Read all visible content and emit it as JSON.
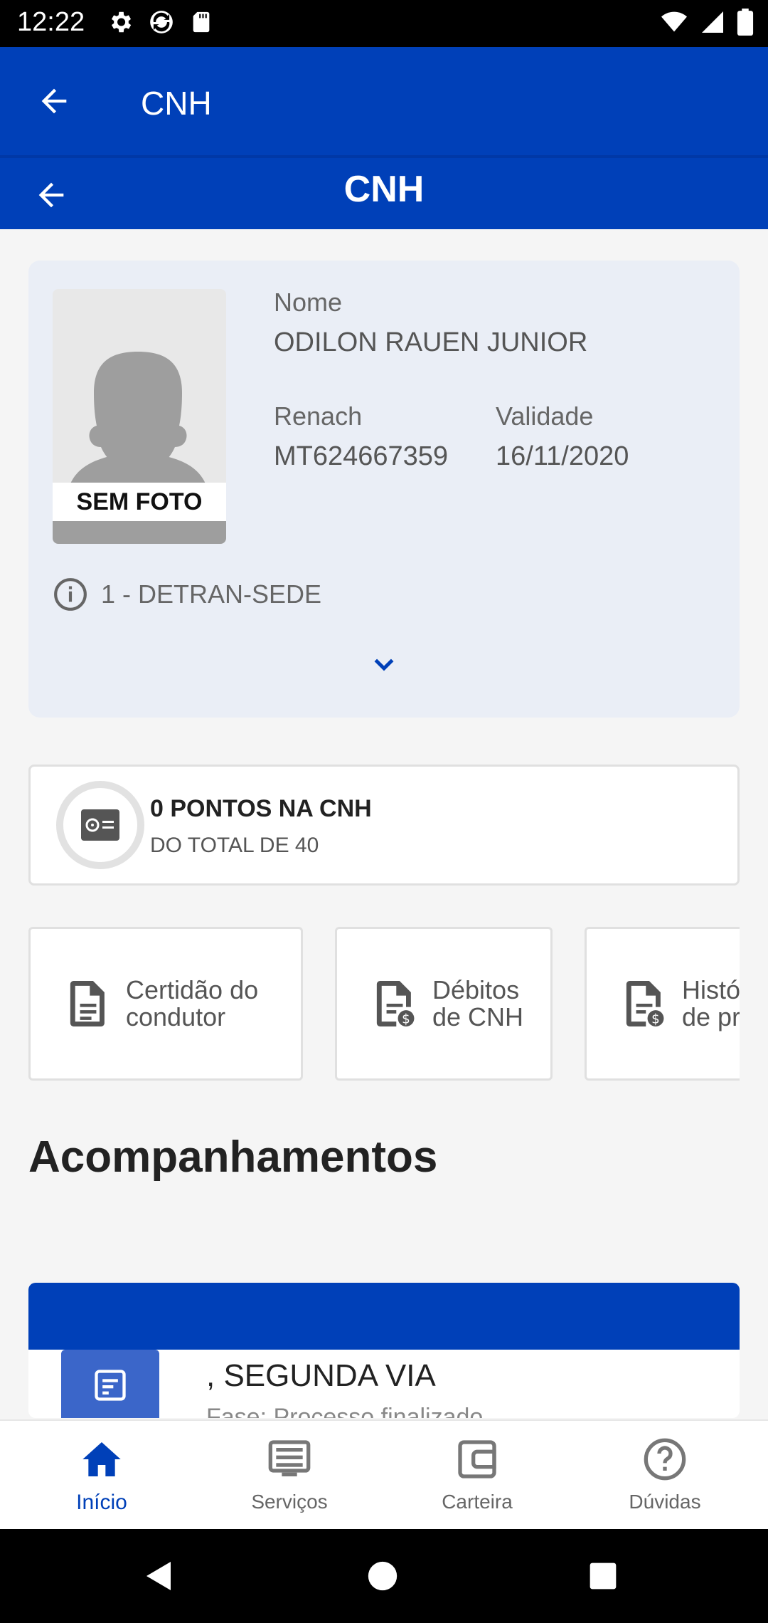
{
  "status_bar": {
    "time": "12:22"
  },
  "app_bar": {
    "title": "CNH"
  },
  "sub_bar": {
    "title": "CNH"
  },
  "cnh": {
    "photo_placeholder": "SEM FOTO",
    "name_label": "Nome",
    "name_value": "ODILON RAUEN JUNIOR",
    "renach_label": "Renach",
    "renach_value": "MT624667359",
    "validity_label": "Validade",
    "validity_value": "16/11/2020",
    "office": "1 - DETRAN-SEDE"
  },
  "points": {
    "title": "0 PONTOS NA CNH",
    "subtitle": "DO TOTAL DE 40"
  },
  "quick_actions": [
    {
      "label": "Certidão do\ncondutor"
    },
    {
      "label": "Débitos\nde CNH"
    },
    {
      "label": "Históri\nde pro"
    }
  ],
  "section": {
    "title": "Acompanhamentos"
  },
  "tracking": {
    "title": ", SEGUNDA VIA",
    "subtitle": "Fase: Processo finalizado"
  },
  "bottom_nav": [
    {
      "label": "Início",
      "icon": "home-icon",
      "active": true
    },
    {
      "label": "Serviços",
      "icon": "services-icon",
      "active": false
    },
    {
      "label": "Carteira",
      "icon": "wallet-icon",
      "active": false
    },
    {
      "label": "Dúvidas",
      "icon": "help-icon",
      "active": false
    }
  ],
  "colors": {
    "primary": "#0040b8",
    "background": "#f5f5f5",
    "card": "#eaeef6"
  }
}
